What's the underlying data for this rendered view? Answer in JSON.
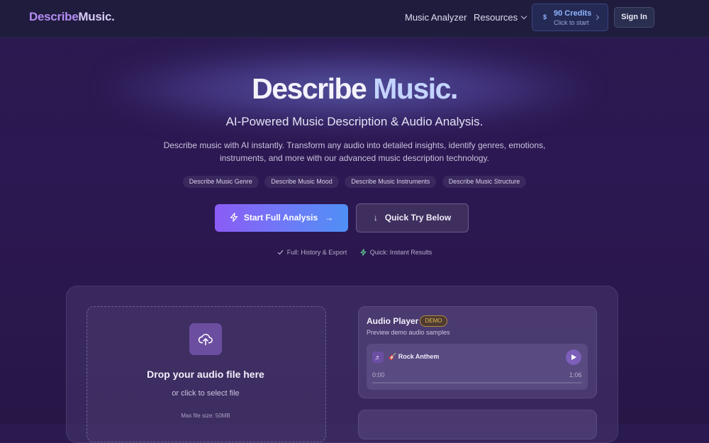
{
  "nav": {
    "logo_part1": "Describe",
    "logo_part2": "Music.",
    "links": [
      "Music Analyzer",
      "Resources"
    ],
    "credits_title": "90 Credits",
    "credits_sub": "Click to start",
    "credits_symbol": "$",
    "sign_in": "Sign In"
  },
  "hero": {
    "title_part1": "Describe",
    "title_part2": "Music.",
    "subtitle": "AI-Powered Music Description & Audio Analysis.",
    "description": "Describe music with AI instantly. Transform any audio into detailed insights, identify genres, emotions, instruments, and more with our advanced music description technology.",
    "tags": [
      "Describe Music Genre",
      "Describe Music Mood",
      "Describe Music Instruments",
      "Describe Music Structure"
    ],
    "primary_button": "Start Full Analysis",
    "primary_arrow": "→",
    "secondary_button": "Quick Try Below",
    "secondary_arrow": "↓",
    "hint_full": "Full: History & Export",
    "hint_quick": "Quick: Instant Results"
  },
  "upload": {
    "title": "Drop your audio file here",
    "subtitle": "or click to select file",
    "max_size": "Max file size: 50MB"
  },
  "player": {
    "title": "Audio Player",
    "badge": "DEMO",
    "subtitle": "Preview demo audio samples",
    "track_icon": "♬",
    "track_name": "🎸 Rock Anthem",
    "time_current": "0:00",
    "time_total": "1:06",
    "progress_fraction": 0.0
  },
  "colors": {
    "accent_purple": "#8b5cf6",
    "accent_blue": "#4f8ff5",
    "demo_badge": "#e6b94f",
    "credits_text": "#8fb6ff"
  }
}
